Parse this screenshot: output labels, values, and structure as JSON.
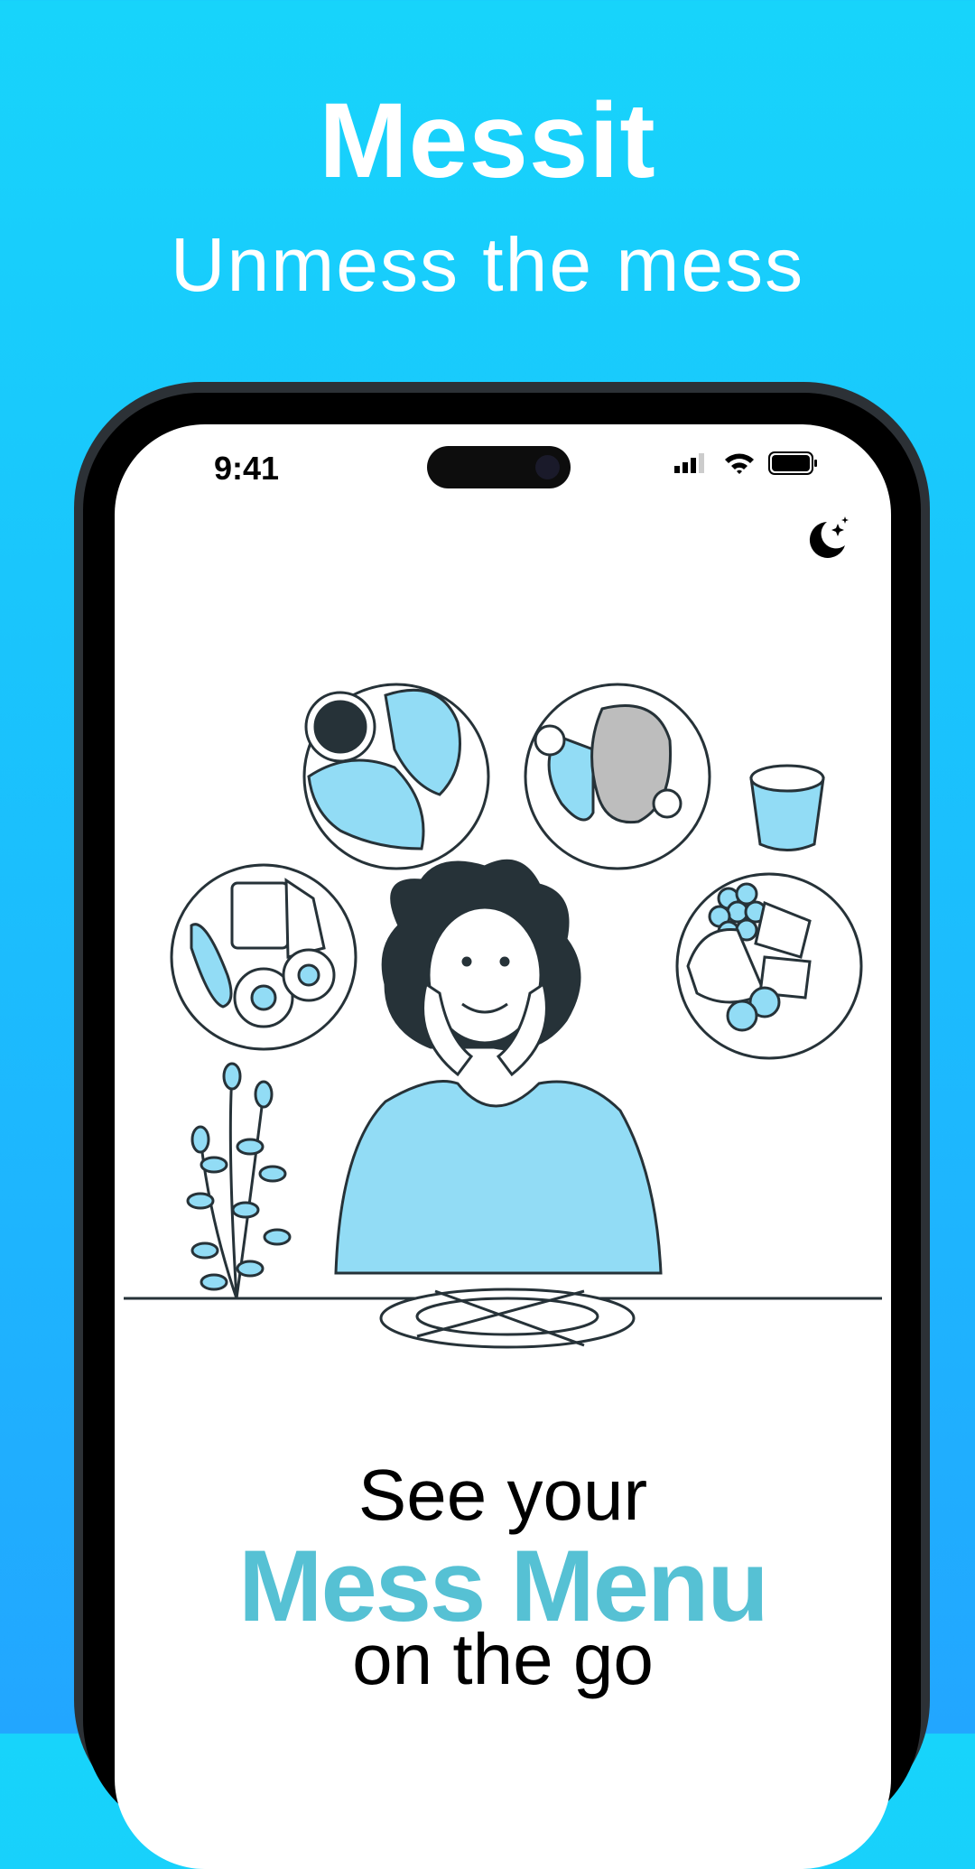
{
  "header": {
    "title": "Messit",
    "subtitle": "Unmess the mess"
  },
  "status_bar": {
    "time": "9:41",
    "icons": [
      "signal-icon",
      "wifi-icon",
      "battery-icon"
    ]
  },
  "theme_toggle": {
    "icon": "moon-stars-icon"
  },
  "tagline": {
    "line1": "See your",
    "highlight": "Mess Menu",
    "line3": "on the go"
  },
  "colors": {
    "accent": "#56c1d4",
    "illustration_fill": "#92dcf5",
    "outline": "#263238"
  }
}
